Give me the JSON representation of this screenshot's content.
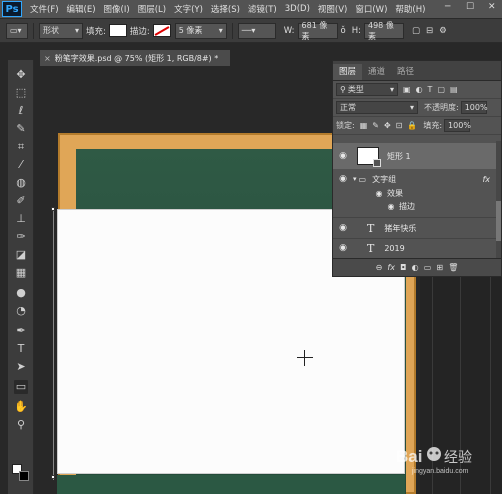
{
  "menubar": {
    "logo": "Ps",
    "items": [
      "文件(F)",
      "编辑(E)",
      "图像(I)",
      "图层(L)",
      "文字(Y)",
      "选择(S)",
      "滤镜(T)",
      "3D(D)",
      "视图(V)",
      "窗口(W)",
      "帮助(H)"
    ],
    "minimize": "─",
    "maximize": "☐",
    "close": "✕"
  },
  "options": {
    "mode": "形状",
    "fill_label": "填充:",
    "stroke_label": "描边:",
    "stroke_width": "5 像素",
    "width_label": "W:",
    "width_value": "681 像素",
    "link": "ǒ",
    "height_label": "H:",
    "height_value": "498 像素"
  },
  "document": {
    "close": "×",
    "title": "粉笔字效果.psd @ 75% (矩形 1, RGB/8#) *"
  },
  "layers_panel": {
    "tabs": [
      "图层",
      "通道",
      "路径"
    ],
    "filter_kind": "类型",
    "blend_mode": "正常",
    "opacity_label": "不透明度:",
    "opacity_value": "100%",
    "lock_label": "锁定:",
    "fill_label": "填充:",
    "fill_value": "100%",
    "layers": [
      {
        "name": "矩形 1",
        "type": "shape",
        "selected": true
      },
      {
        "name": "文字组",
        "type": "group",
        "fx": "fx"
      },
      {
        "name": "效果",
        "type": "effects"
      },
      {
        "name": "描边",
        "type": "effect-item"
      },
      {
        "name": "猪年快乐",
        "type": "text"
      },
      {
        "name": "2019",
        "type": "text"
      }
    ]
  },
  "tools": [
    "move",
    "marquee",
    "lasso",
    "quick-select",
    "crop",
    "eyedropper",
    "healing",
    "brush",
    "clone-stamp",
    "history-brush",
    "eraser",
    "gradient",
    "blur",
    "dodge",
    "pen",
    "type",
    "path-select",
    "rectangle",
    "hand",
    "zoom"
  ],
  "watermark": {
    "brand": "Bai",
    "cn_suffix": "经验",
    "sub": "jingyan.baidu.com"
  },
  "colors": {
    "menubar": "#535353",
    "optionsbar": "#3c3c3c",
    "panel": "#535353",
    "frame": "#e0a657",
    "board": "#2a5240",
    "shape_fill": "#fcfcfc"
  }
}
